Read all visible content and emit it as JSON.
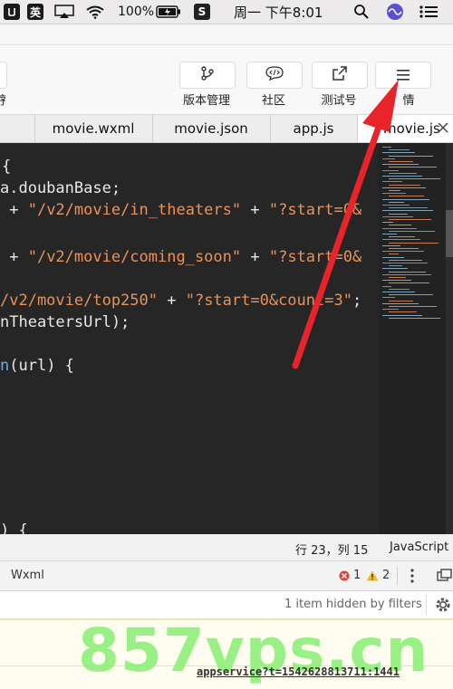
{
  "menubar": {
    "ime_label": "英",
    "battery": "100%",
    "clock": "周一 下午8:01"
  },
  "toolbar": {
    "items": [
      {
        "label": "版本管理",
        "icon": "branch-icon"
      },
      {
        "label": "社区",
        "icon": "chat-icon"
      },
      {
        "label": "测试号",
        "icon": "external-link-icon"
      },
      {
        "label": "情",
        "icon": "menu-icon"
      }
    ],
    "left_partial_label": "序"
  },
  "tabs": [
    {
      "label": "movie.wxml"
    },
    {
      "label": "movie.json"
    },
    {
      "label": "app.js"
    },
    {
      "label": "movie.js",
      "active": true
    }
  ],
  "code": [
    {
      "parts": [
        {
          "c": "w",
          "t": "{"
        }
      ]
    },
    {
      "parts": [
        {
          "c": "w",
          "t": "a.doubanBase;"
        }
      ]
    },
    {
      "parts": [
        {
          "c": "w",
          "t": " + "
        },
        {
          "c": "s",
          "t": "\"/v2/movie/in_theaters\""
        },
        {
          "c": "w",
          "t": " + "
        },
        {
          "c": "s",
          "t": "\"?start=0&"
        }
      ]
    },
    {
      "parts": [
        {
          "c": "w",
          "t": ""
        }
      ]
    },
    {
      "parts": [
        {
          "c": "w",
          "t": " + "
        },
        {
          "c": "s",
          "t": "\"/v2/movie/coming_soon\""
        },
        {
          "c": "w",
          "t": " + "
        },
        {
          "c": "s",
          "t": "\"?start=0&"
        }
      ]
    },
    {
      "parts": [
        {
          "c": "w",
          "t": ""
        }
      ]
    },
    {
      "parts": [
        {
          "c": "s",
          "t": "/v2/movie/top250\""
        },
        {
          "c": "w",
          "t": " + "
        },
        {
          "c": "s",
          "t": "\"?start=0&count=3\""
        },
        {
          "c": "w",
          "t": ";"
        }
      ]
    },
    {
      "parts": [
        {
          "c": "w",
          "t": "nTheatersUrl);"
        }
      ]
    },
    {
      "parts": [
        {
          "c": "w",
          "t": ""
        }
      ]
    },
    {
      "parts": [
        {
          "c": "f",
          "t": "n"
        },
        {
          "c": "w",
          "t": "(url) {"
        }
      ]
    }
  ],
  "code_tail": {
    "parts": [
      {
        "c": "w",
        "t": ") {"
      }
    ]
  },
  "status": {
    "position": "行 23，列 15",
    "language": "JavaScript"
  },
  "panel": {
    "tab_label": "Wxml",
    "error_count": "1",
    "warning_count": "2"
  },
  "filter": {
    "hidden_text": "1 item hidden by filters"
  },
  "console": {
    "link_text": "appservice?t=1542628813711:1441"
  },
  "watermark": {
    "text": "857vps.cn"
  },
  "colors": {
    "arrow": "#e8232a",
    "string": "#e9925a",
    "editor_bg": "#262626"
  }
}
